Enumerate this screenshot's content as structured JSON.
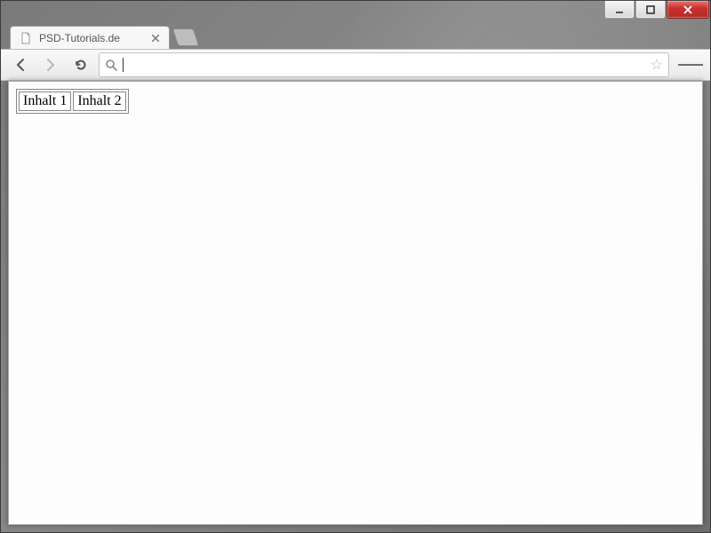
{
  "tab": {
    "title": "PSD-Tutorials.de"
  },
  "omnibox": {
    "value": "",
    "placeholder": ""
  },
  "page": {
    "table": {
      "rows": [
        {
          "cells": [
            "Inhalt 1",
            "Inhalt 2"
          ]
        }
      ]
    }
  }
}
